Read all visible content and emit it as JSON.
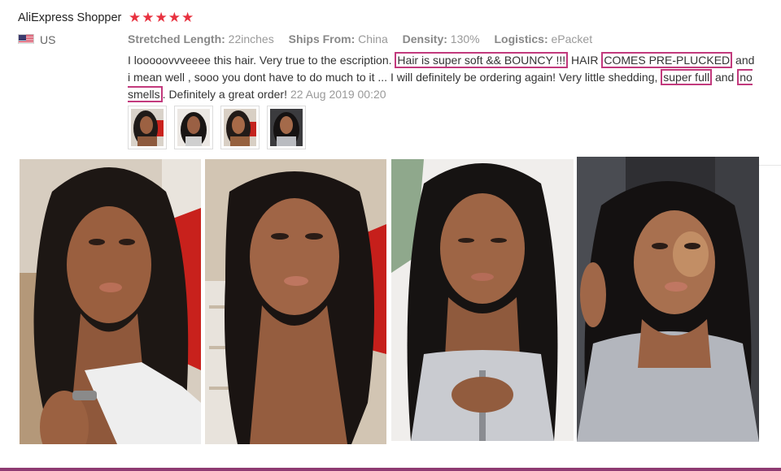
{
  "review": {
    "reviewer_name": "AliExpress Shopper",
    "rating": 5,
    "stars_text": "★★★★★",
    "country": "US",
    "flag_icon": "us-flag-icon",
    "attributes": [
      {
        "label": "Stretched Length:",
        "value": "22inches"
      },
      {
        "label": "Ships From:",
        "value": "China"
      },
      {
        "label": "Density:",
        "value": "130%"
      },
      {
        "label": "Logistics:",
        "value": "ePacket"
      }
    ],
    "text_parts": {
      "p1": "I looooovvveeee this hair. Very true to the escription. ",
      "h1": "Hair is super soft && BOUNCY !!!",
      "p2": " HAIR ",
      "h2": "COMES PRE-PLUCKED",
      "p3": " and i mean well , sooo you dont have to do much to it ... I will definitely be ordering again! Very little shedding, ",
      "h3": "super full",
      "p4": " and ",
      "h4": "no smells",
      "p5": ". Definitely a great order!"
    },
    "date": "22 Aug 2019 00:20"
  },
  "colors": {
    "star": "#e8313f",
    "highlight_box": "#c23a7d",
    "bottom_bar": "#8e3a72"
  }
}
